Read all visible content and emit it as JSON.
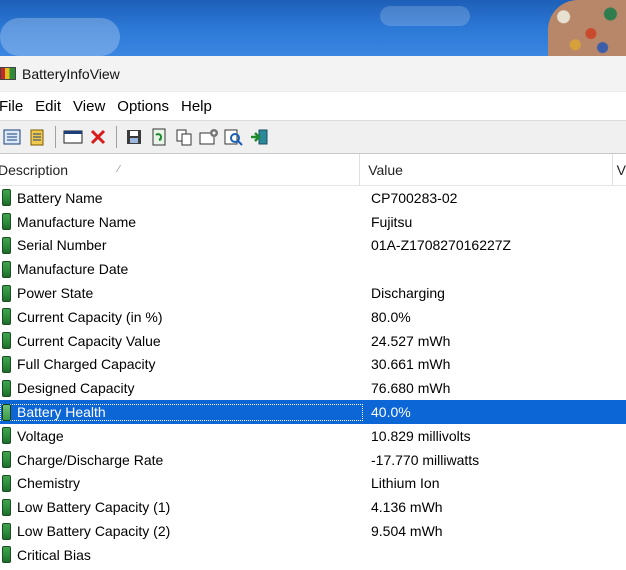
{
  "window": {
    "title": "BatteryInfoView"
  },
  "menu": [
    "File",
    "Edit",
    "View",
    "Options",
    "Help"
  ],
  "columns": {
    "description": "Description",
    "value": "Value",
    "extra": "V"
  },
  "rows": [
    {
      "description": "Battery Name",
      "value": "CP700283-02"
    },
    {
      "description": "Manufacture Name",
      "value": "Fujitsu"
    },
    {
      "description": "Serial Number",
      "value": "01A-Z170827016227Z"
    },
    {
      "description": "Manufacture Date",
      "value": ""
    },
    {
      "description": "Power State",
      "value": "Discharging"
    },
    {
      "description": "Current Capacity (in %)",
      "value": "80.0%"
    },
    {
      "description": "Current Capacity Value",
      "value": "24.527 mWh"
    },
    {
      "description": "Full Charged Capacity",
      "value": "30.661 mWh"
    },
    {
      "description": "Designed Capacity",
      "value": "76.680 mWh"
    },
    {
      "description": "Battery Health",
      "value": "40.0%"
    },
    {
      "description": "Voltage",
      "value": "10.829 millivolts"
    },
    {
      "description": "Charge/Discharge Rate",
      "value": "-17.770 milliwatts"
    },
    {
      "description": "Chemistry",
      "value": "Lithium Ion"
    },
    {
      "description": "Low Battery Capacity (1)",
      "value": "4.136 mWh"
    },
    {
      "description": "Low Battery Capacity (2)",
      "value": "9.504 mWh"
    },
    {
      "description": "Critical Bias",
      "value": ""
    }
  ],
  "selected_row": "Battery Health",
  "colors": {
    "selection": "#0c66d6",
    "battery_icon": "#2b8a38"
  }
}
